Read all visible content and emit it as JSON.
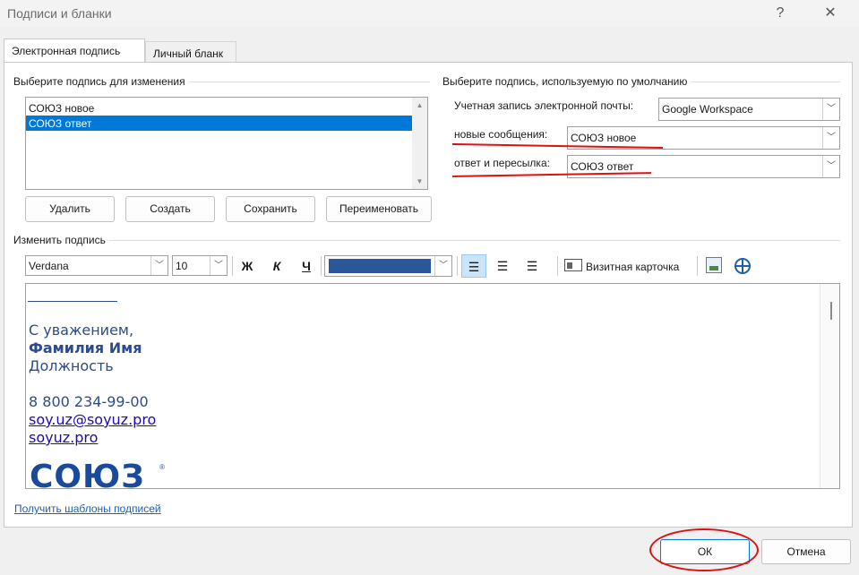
{
  "window": {
    "title": "Подписи и бланки",
    "help_glyph": "?",
    "close_glyph": "✕"
  },
  "tabs": [
    {
      "label": "Электронная подпись",
      "active": true
    },
    {
      "label": "Личный бланк",
      "active": false
    }
  ],
  "select_group": {
    "label": "Выберите подпись для изменения",
    "items": [
      {
        "label": "СОЮЗ новое",
        "selected": false
      },
      {
        "label": "СОЮЗ ответ",
        "selected": true
      }
    ]
  },
  "buttons": {
    "delete": "Удалить",
    "create": "Создать",
    "save": "Сохранить",
    "rename": "Переименовать",
    "ok": "ОК",
    "cancel": "Отмена"
  },
  "default_group": {
    "label": "Выберите подпись, используемую по умолчанию",
    "account_label": "Учетная запись электронной почты:",
    "account_value": "Google Workspace",
    "new_label": "новые сообщения:",
    "new_value": "СОЮЗ новое",
    "reply_label": "ответ и пересылка:",
    "reply_value": "СОЮЗ ответ"
  },
  "edit_group": {
    "label": "Изменить подпись"
  },
  "toolbar": {
    "font": "Verdana",
    "size": "10",
    "bold": "Ж",
    "italic": "К",
    "underline": "Ч",
    "font_color": "#2b579a",
    "business_card": "Визитная карточка"
  },
  "signature": {
    "greeting": "С уважением,",
    "name": "Фамилия Имя",
    "position": "Должность",
    "phone": "8 800 234-99-00",
    "email": "soy.uz@soyuz.pro",
    "site": "soyuz.pro",
    "logo_text": "СОЮЗ",
    "logo_mark": "®"
  },
  "templates_link": "Получить шаблоны подписей",
  "colors": {
    "accent": "#0078d7",
    "annotation": "#e01010",
    "signature_text": "#2b4c8c"
  }
}
